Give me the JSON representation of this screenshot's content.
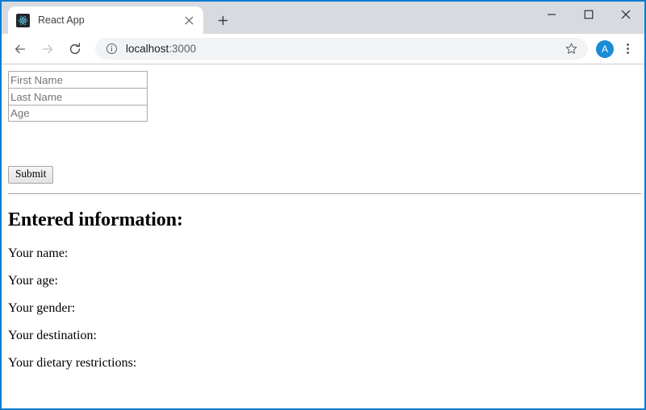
{
  "window": {
    "controls": {
      "minimize_label": "Minimize",
      "maximize_label": "Maximize",
      "close_label": "Close"
    }
  },
  "tabstrip": {
    "tabs": [
      {
        "title": "React App",
        "favicon": "react-logo-icon",
        "close_label": "×",
        "active": true
      }
    ],
    "new_tab_label": "+"
  },
  "toolbar": {
    "back_label": "Back",
    "forward_label": "Forward",
    "reload_label": "Reload",
    "site_info_icon": "info-circle-icon",
    "url_host": "localhost",
    "url_port": ":3000",
    "url_full": "localhost:3000",
    "bookmark_label": "Bookmark this tab",
    "avatar_initial": "A",
    "menu_label": "Customize and control Google Chrome"
  },
  "page": {
    "form": {
      "fields": [
        {
          "name": "first-name",
          "value": "",
          "placeholder": "First Name"
        },
        {
          "name": "last-name",
          "value": "",
          "placeholder": "Last Name"
        },
        {
          "name": "age",
          "value": "",
          "placeholder": "Age"
        }
      ],
      "submit_label": "Submit"
    },
    "results": {
      "heading": "Entered information:",
      "lines": [
        "Your name:",
        "Your age:",
        "Your gender:",
        "Your destination:",
        "Your dietary restrictions:"
      ]
    }
  },
  "colors": {
    "window_border": "#0d7bce",
    "tabstrip_bg": "#d7dbdf",
    "active_tab_bg": "#ffffff",
    "omnibox_bg": "#f1f3f4",
    "avatar_bg": "#1a8cd6",
    "react_logo": "#61dafb",
    "favicon_bg": "#21262c"
  }
}
